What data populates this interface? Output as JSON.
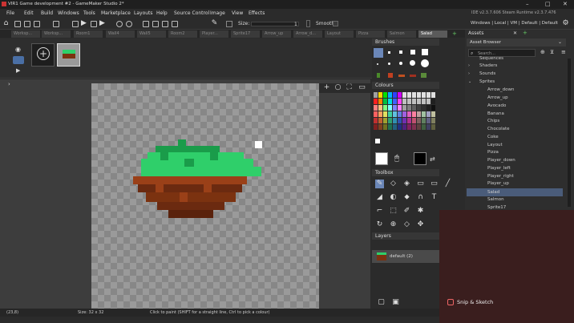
{
  "window": {
    "title": "VIR1 Game development #2 - GameMaker Studio 2*",
    "min": "–",
    "max": "□",
    "close": "✕"
  },
  "menu": [
    "File",
    "Edit",
    "Build",
    "Windows",
    "Tools",
    "Marketplace",
    "Layouts",
    "Help",
    "Source Control",
    "Image",
    "View",
    "Effects"
  ],
  "ide_version": "IDE v2.3.7.606 Steam  Runtime v2.3.7.476",
  "layout_links": "Windows | Local | VM | Default | Default",
  "size": {
    "label": "Size:",
    "value": "1"
  },
  "smooth_label": "Smooth",
  "tabs": [
    "Worksp...",
    "Worksp...",
    "Room1",
    "Wall4",
    "Wall5",
    "Room2",
    "Player...",
    "Sprite17",
    "Arrow_up",
    "Arrow_d...",
    "Layout",
    "Pizza",
    "Salmon",
    "Salad"
  ],
  "active_tab": "Salad",
  "brushes": {
    "title": "Brushes"
  },
  "colours": {
    "title": "Colours",
    "palette": [
      "#a0a0a0",
      "#ffd800",
      "#00e000",
      "#00b0ff",
      "#3040ff",
      "#d000ff",
      "#e0e0e0",
      "#e0e0e0",
      "#e0e0e0",
      "#e0e0e0",
      "#e0e0e0",
      "#e0e0e0",
      "#e0e0e0",
      "#ff2020",
      "#ff8000",
      "#00c040",
      "#00e0e0",
      "#4060ff",
      "#ff40ff",
      "#c0c0c0",
      "#c0c0c0",
      "#c0c0c0",
      "#c0c0c0",
      "#c0c0c0",
      "#c0c0c0",
      "#202020",
      "#ff8080",
      "#ffc080",
      "#80ff80",
      "#80ffff",
      "#8080ff",
      "#ff80ff",
      "#a0a0a0",
      "#808080",
      "#606060",
      "#404040",
      "#303030",
      "#202020",
      "#101010",
      "#ff6060",
      "#ffa060",
      "#e0e060",
      "#40d0a0",
      "#60c0e0",
      "#6080e0",
      "#a060e0",
      "#e060c0",
      "#ff80a0",
      "#c0a0a0",
      "#a0c0a0",
      "#a0a0c0",
      "#c0c0a0",
      "#c03030",
      "#c06030",
      "#a0a030",
      "#30a070",
      "#3090b0",
      "#3050b0",
      "#7030b0",
      "#b03090",
      "#c05070",
      "#806060",
      "#608060",
      "#606080",
      "#808060",
      "#802020",
      "#804020",
      "#707020",
      "#207050",
      "#206080",
      "#203080",
      "#502080",
      "#802060",
      "#803050",
      "#604040",
      "#406040",
      "#404060",
      "#606040"
    ],
    "primary": "#ffffff",
    "secondary": "#000000"
  },
  "toolbox": {
    "title": "Toolbox"
  },
  "layers": {
    "title": "Layers",
    "items": [
      {
        "name": "default (2)"
      }
    ]
  },
  "assets": {
    "tab": "Assets",
    "browser_title": "Asset Browser",
    "search_placeholder": "Search...",
    "groups": [
      "Sequences",
      "Shaders",
      "Sounds",
      "Sprites"
    ],
    "sprites": [
      "Arrow_down",
      "Arrow_up",
      "Avocado",
      "Banana",
      "Chips",
      "Chocolate",
      "Coke",
      "Layout",
      "Pizza",
      "Player_down",
      "Player_left",
      "Player_right",
      "Player_up",
      "Salad",
      "Salmon",
      "Sprite17"
    ],
    "selected": "Salad"
  },
  "status": {
    "coords": "(23,8)",
    "size": "Size: 32 x 32",
    "hint": "Click to paint (SHIFT for a straight line, Ctrl to pick a colour)"
  },
  "snip": {
    "label": "Snip & Sketch"
  },
  "colors": {
    "grass_light": "#2fcf6a",
    "grass_dark": "#1a9c4a",
    "dirt_dark": "#6b2a10",
    "dirt_light": "#9a4018",
    "accent": "#4a6fa5"
  }
}
